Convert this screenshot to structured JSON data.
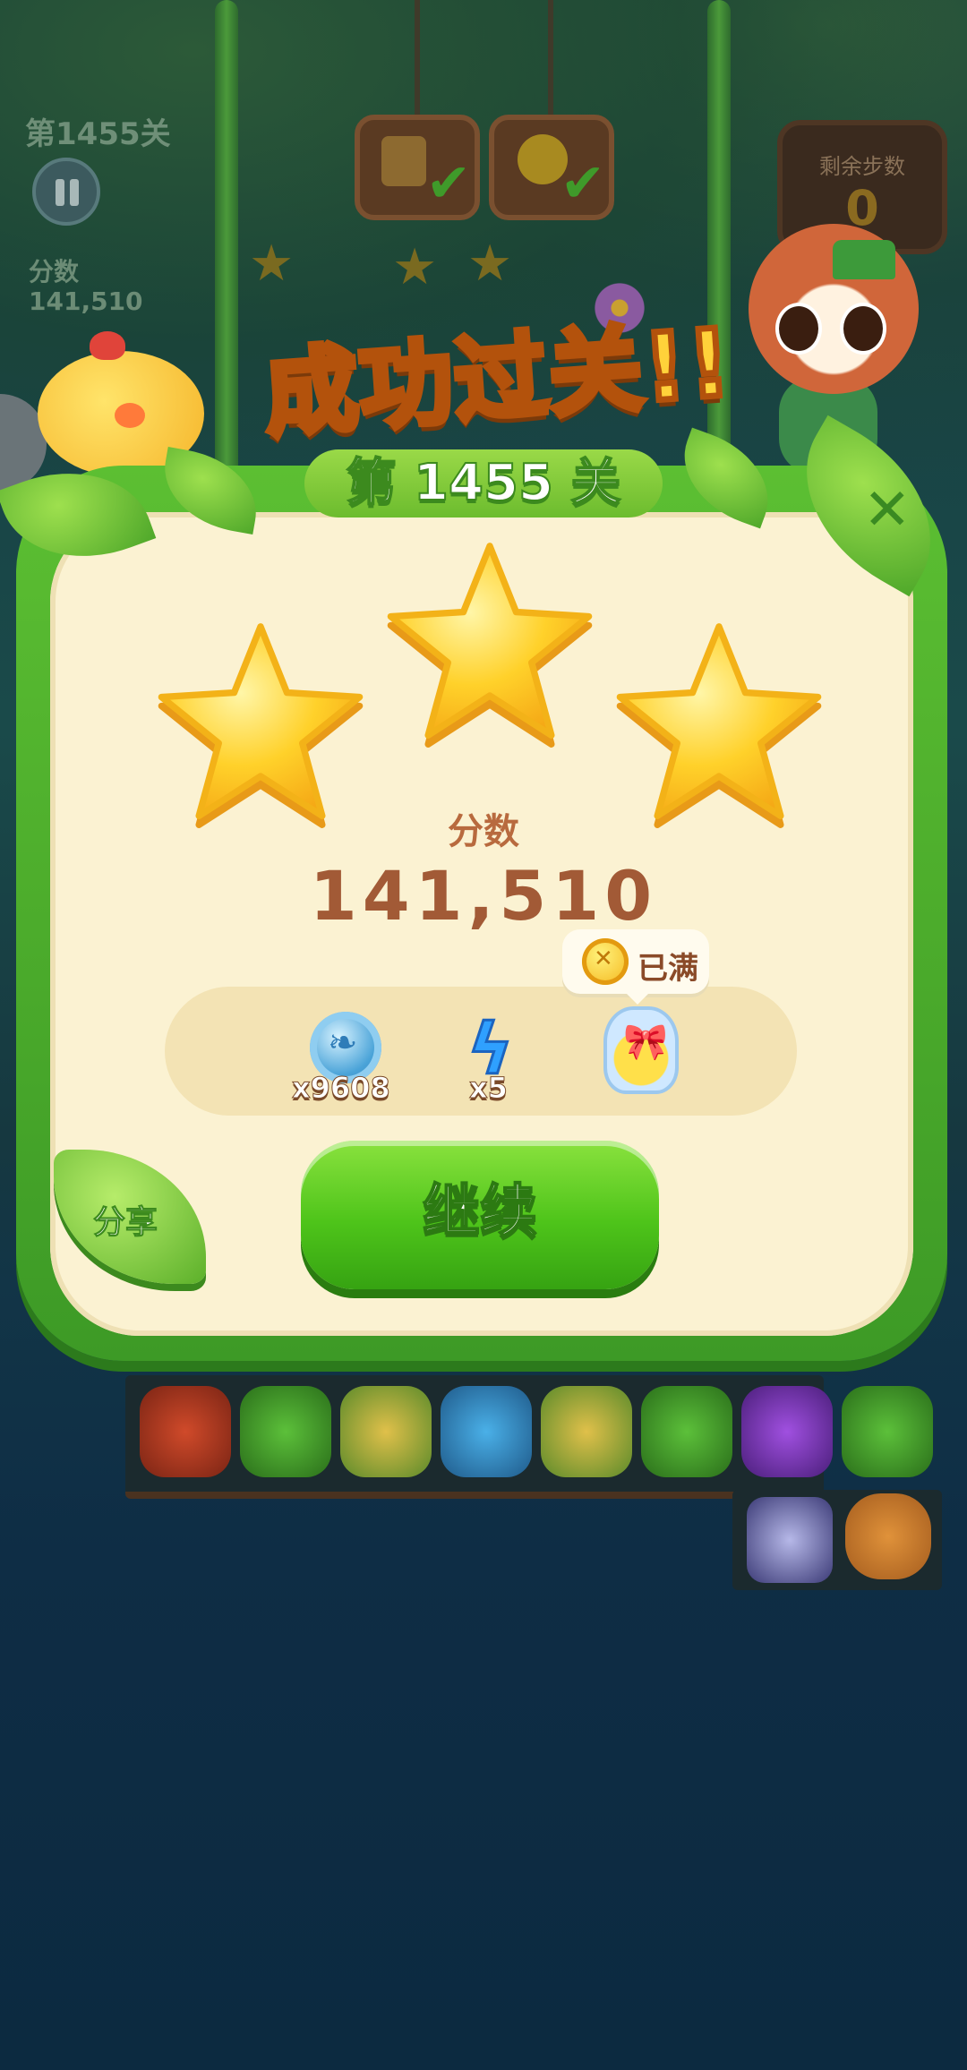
{
  "hud": {
    "level_label": "第1455关",
    "score_label": "分数",
    "score_value": "141,510",
    "moves_label": "剩余步数",
    "moves_value": "0"
  },
  "result": {
    "banner": "成功过关!!",
    "level_tag": "第 1455 关",
    "stars_earned": 3,
    "score_label": "分数",
    "score_value": "141,510",
    "rewards": [
      {
        "icon": "silver-coin-icon",
        "count": "x9608"
      },
      {
        "icon": "energy-bolt-icon",
        "count": "x5"
      },
      {
        "icon": "star-jar-icon",
        "count": ""
      }
    ],
    "tooltip_text": "已满",
    "continue_label": "继续",
    "share_label": "分享",
    "close_symbol": "✕"
  },
  "colors": {
    "panel": "#fbf2d2",
    "frame_green": "#4fae28",
    "score_brown": "#a25a36",
    "button_green": "#4ec41a",
    "star_gold": "#ffcf2a"
  }
}
